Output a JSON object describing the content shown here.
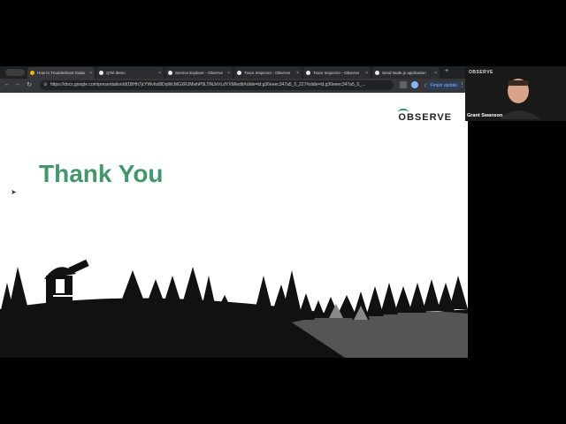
{
  "browser": {
    "tabs": [
      {
        "title": "How to Troubleshoot Galax",
        "favicon_color": "#f4b400",
        "active": true
      },
      {
        "title": "QTel demo",
        "favicon_color": "#e8eaed",
        "active": false
      },
      {
        "title": "Service Explorer - Observe",
        "favicon_color": "#e8eaed",
        "active": false
      },
      {
        "title": "Trace Inspector - Observe",
        "favicon_color": "#e8eaed",
        "active": false
      },
      {
        "title": "Trace Inspector - Observe",
        "favicon_color": "#e8eaed",
        "active": false
      },
      {
        "title": "Send Node.js application",
        "favicon_color": "#e8eaed",
        "active": false
      }
    ],
    "url": "https://docs.google.com/presentation/d/1BHh7jcYWvhs8IDqWcMGXRJMwhP9LTlNJsVLdYXM/edit#slide=id.g36eeec347a5_0_227#slide=id.g36eeec347a5_0_...",
    "finish_update_label": "Finish update"
  },
  "slide": {
    "logo_text": "OBSERVE",
    "title": "Thank You"
  },
  "webcam": {
    "logo_text": "OBSERVE",
    "participant_name": "Grant Swanson"
  }
}
